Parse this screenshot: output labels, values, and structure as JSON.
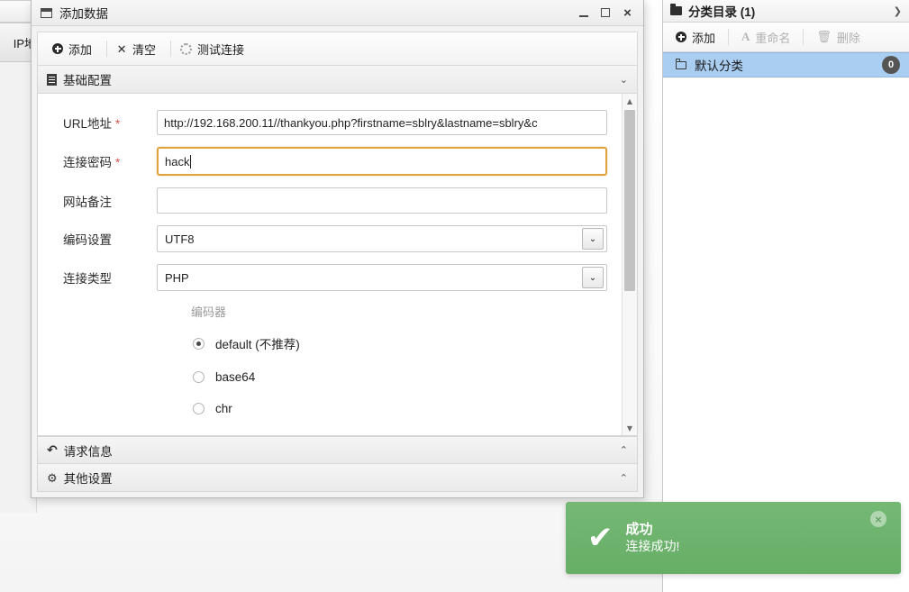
{
  "background": {
    "column_header": "IP地"
  },
  "dialog": {
    "title": "添加数据",
    "icon": "window-icon",
    "window_controls": {
      "minimize": "minimize-icon",
      "maximize": "maximize-icon",
      "close": "×"
    },
    "toolbar": [
      {
        "label": "添加",
        "icon": "plus-circle-icon"
      },
      {
        "label": "清空",
        "icon": "x-icon"
      },
      {
        "label": "测试连接",
        "icon": "spinner-icon"
      }
    ],
    "sections": [
      {
        "label": "基础配置",
        "icon": "document-icon",
        "chevron": "⌄",
        "expanded": true
      },
      {
        "label": "请求信息",
        "icon": "refresh-icon",
        "chevron": "⌃",
        "expanded": false
      },
      {
        "label": "其他设置",
        "icon": "gears-icon",
        "chevron": "⌃",
        "expanded": false
      }
    ],
    "form": {
      "fields": [
        {
          "label": "URL地址",
          "required": "*",
          "value": "http://192.168.200.11//thankyou.php?firstname=sblry&lastname=sblry&c",
          "type": "text",
          "focused": false
        },
        {
          "label": "连接密码",
          "required": "*",
          "value": "hack",
          "type": "text",
          "focused": true
        },
        {
          "label": "网站备注",
          "required": "",
          "value": "",
          "type": "text",
          "focused": false
        },
        {
          "label": "编码设置",
          "required": "",
          "value": "UTF8",
          "type": "select",
          "arrow": "⌄"
        },
        {
          "label": "连接类型",
          "required": "",
          "value": "PHP",
          "type": "select",
          "arrow": "⌄"
        }
      ],
      "encoder_group_label": "编码器",
      "encoder_options": [
        {
          "label": "default (不推荐)",
          "checked": true
        },
        {
          "label": "base64",
          "checked": false
        },
        {
          "label": "chr",
          "checked": false
        }
      ]
    },
    "scrollbar": {
      "up": "▲",
      "down": "▼"
    }
  },
  "right_panel": {
    "header": {
      "title": "分类目录 (1)",
      "icon": "folder-solid-icon",
      "collapse_arrow": "❯"
    },
    "toolbar": [
      {
        "label": "添加",
        "icon": "plus-circle-icon",
        "disabled": false
      },
      {
        "label": "重命名",
        "icon": "letter-a-icon",
        "disabled": true
      },
      {
        "label": "删除",
        "icon": "trash-icon",
        "disabled": true
      }
    ],
    "list": [
      {
        "label": "默认分类",
        "icon": "folder-outline-icon",
        "count": "0",
        "selected": true
      }
    ]
  },
  "toast": {
    "icon": "✔",
    "title": "成功",
    "message": "连接成功!",
    "close": "×",
    "color": "#6cb36c"
  }
}
